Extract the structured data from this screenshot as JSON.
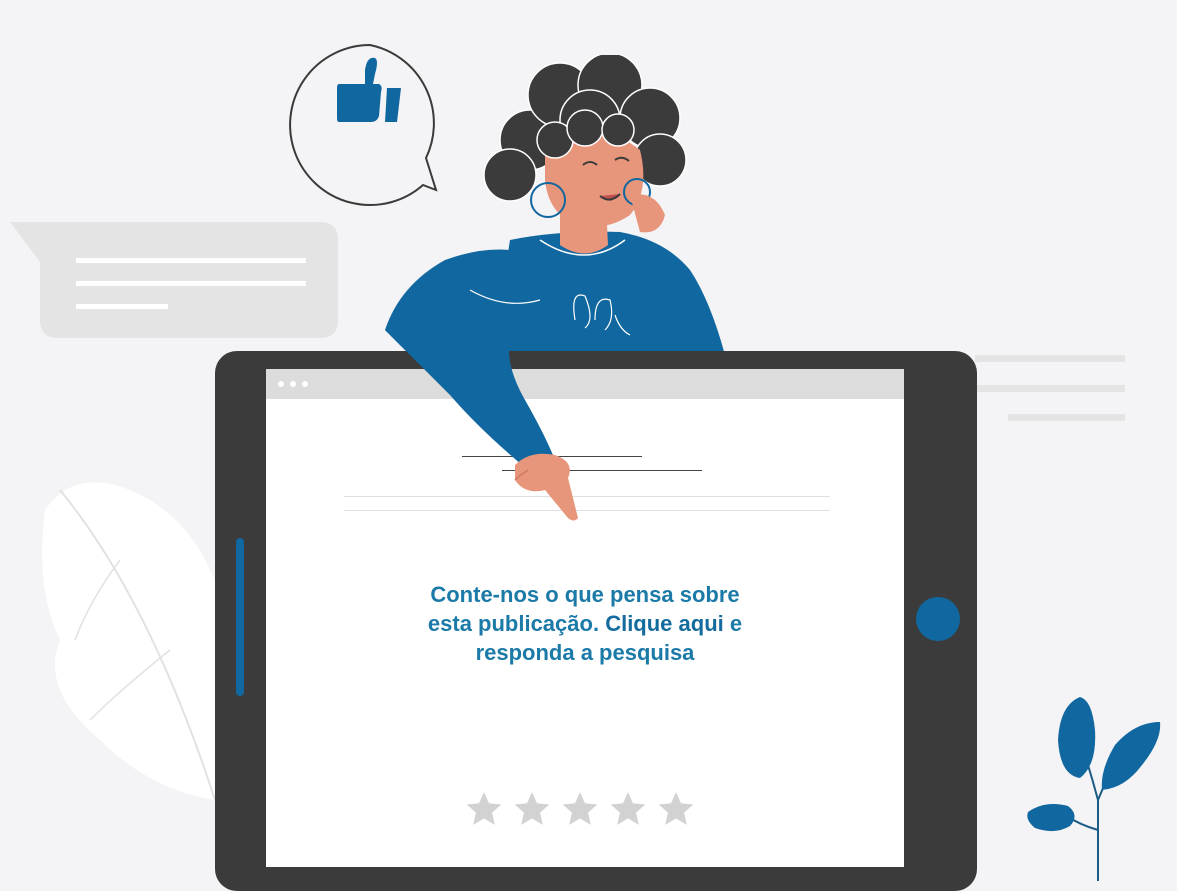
{
  "survey": {
    "line1": "Conte-nos o que pensa sobre",
    "line2_prefix": "esta publicação. ",
    "link_label": "Clique aqui",
    "line2_suffix": " e",
    "line3": "responda a pesquisa",
    "rating_max": 5,
    "rating_value": 0
  },
  "icons": {
    "speech_bubble": "thumbs-up-icon",
    "rating": "star-icon"
  },
  "colors": {
    "background": "#f4f3f5",
    "brand_blue": "#1168a0",
    "text_blue": "#1b7aa7",
    "tablet_frame": "#3b3b3b",
    "star_inactive": "#d2d2d2"
  }
}
